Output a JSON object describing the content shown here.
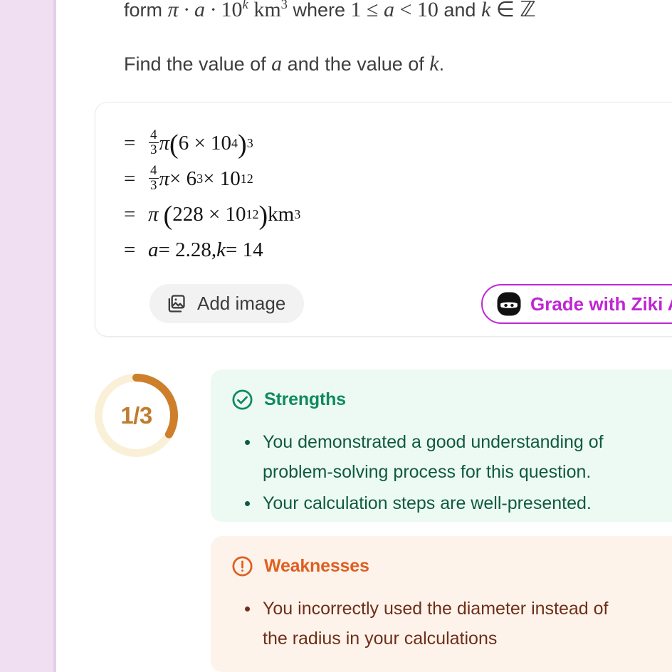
{
  "question": {
    "line1_prefix": "form ",
    "line1_math_a": "π · a · 10",
    "line1_exp": "k",
    "line1_unit": " km",
    "line1_unit_exp": "3",
    "line1_mid": " where ",
    "line1_cond1": "1 ≤ a < 10",
    "line1_and": " and ",
    "line1_cond2": "k ∈ ℤ",
    "line2": "Find the value of a and the value of k."
  },
  "work_card": {
    "lines": [
      "= 4/3 π(6 × 10⁴)³",
      "= 4/3 π × 6³ × 10¹²",
      "= π (228 × 10¹²)km³",
      "= a = 2.28, k = 14"
    ],
    "l1": {
      "eq": "=",
      "num": "4",
      "den": "3",
      "pi": "π",
      "open": "(",
      "base": "6 × 10",
      "exp": "4",
      "close": ")",
      "outer_exp": "3"
    },
    "l2": {
      "eq": "=",
      "num": "4",
      "den": "3",
      "pi": "π",
      "times1": " × 6",
      "exp1": "3",
      "times2": " × 10",
      "exp2": "12"
    },
    "l3": {
      "eq": "=",
      "pi": "π",
      "open": "(",
      "inner": "228 × 10",
      "exp": "12",
      "close": ")",
      "unit": "km",
      "unit_exp": "3"
    },
    "l4": {
      "eq": "=",
      "text_a": "a",
      "eqq": " = 2.28, ",
      "text_k": "k",
      "eqk": " = 14"
    },
    "add_image_label": "Add image",
    "add_image_icon": "image-stack-icon",
    "grade_label": "Grade with Ziki AI",
    "grade_icon": "ninja-icon"
  },
  "score": {
    "value": "1/3",
    "fraction_numerator": 1,
    "fraction_denominator": 3,
    "ring_color": "#cd7f2b",
    "ring_track_color": "#faf0d8"
  },
  "feedback": [
    {
      "id": "strengths",
      "title": "Strengths",
      "icon": "check-circle-icon",
      "accent": "#108a5e",
      "background": "#edfaf3",
      "items": [
        {
          "line1": "You demonstrated a good understanding of",
          "line2": "problem-solving process for this question."
        },
        {
          "line1": "Your calculation steps are well-presented.",
          "line2": ""
        }
      ]
    },
    {
      "id": "weaknesses",
      "title": "Weaknesses",
      "icon": "exclamation-circle-icon",
      "accent": "#de5f22",
      "background": "#fdf3ea",
      "items": [
        {
          "line1": "You incorrectly used the diameter instead of",
          "line2": "the radius in your calculations"
        }
      ]
    }
  ],
  "colors": {
    "sidebar": "#f0dff3",
    "brand_purple": "#c026d3",
    "score_orange": "#c07c2e",
    "strengths_green": "#108a5e",
    "weaknesses_orange": "#de5f22"
  }
}
